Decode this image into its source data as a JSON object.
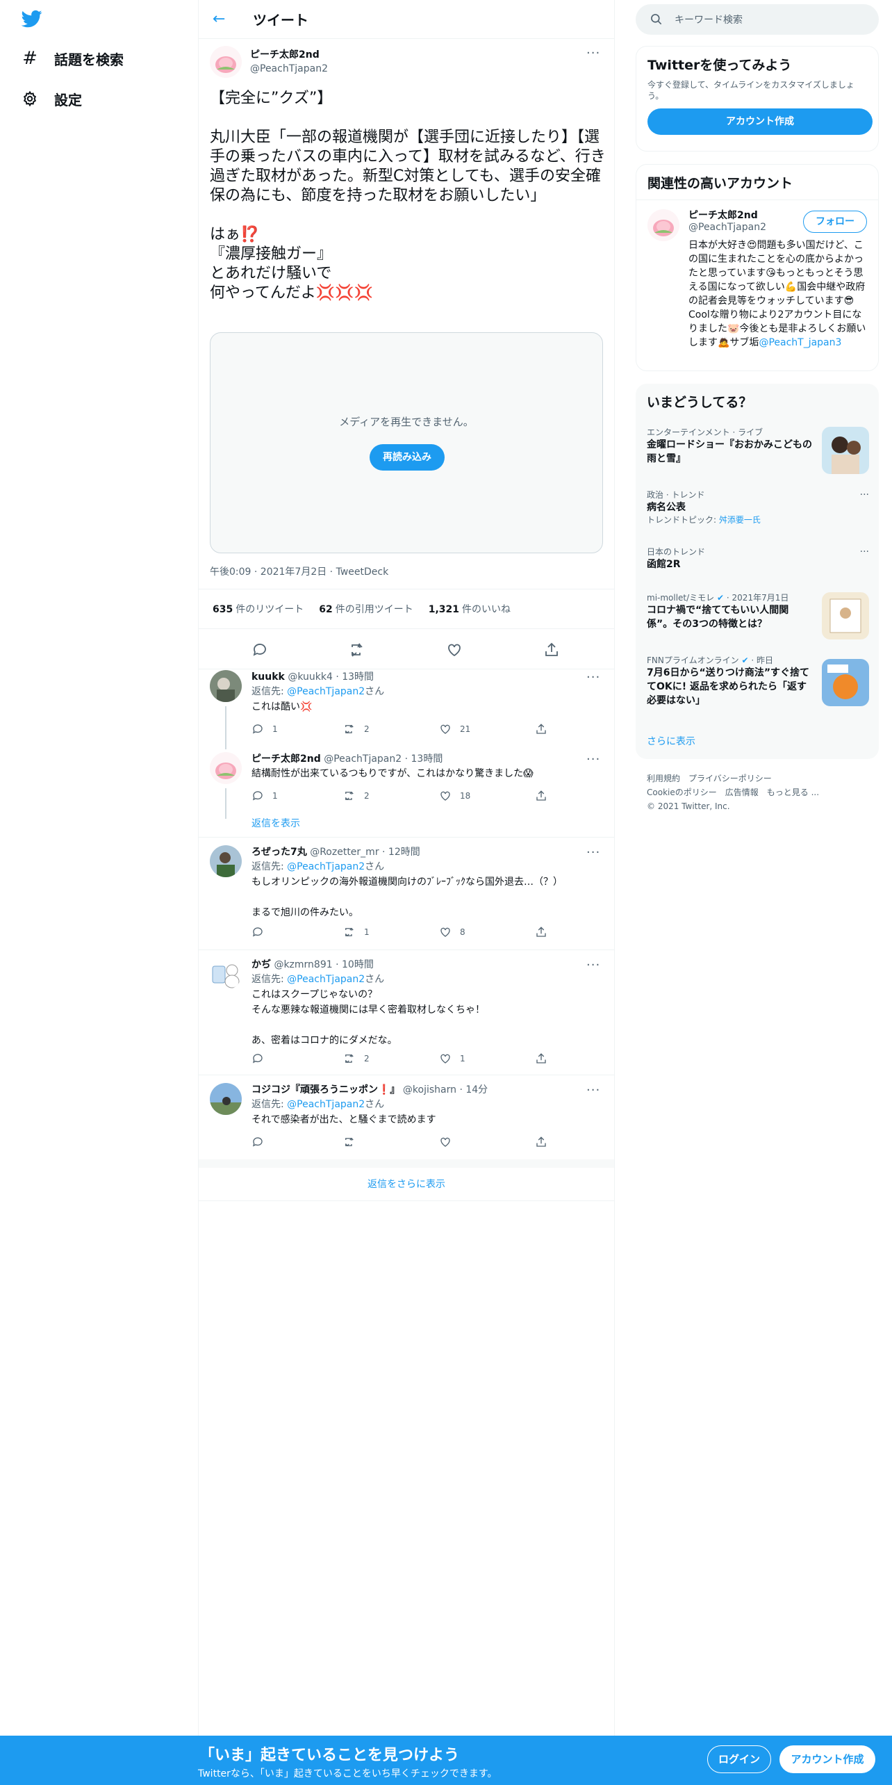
{
  "nav": {
    "explore_label": "話題を検索",
    "settings_label": "設定"
  },
  "header": {
    "title": "ツイート"
  },
  "tweet": {
    "name": "ピーチ太郎2nd",
    "handle": "@PeachTjapan2",
    "text": "【完全に”クズ”】\n\n丸川大臣「一部の報道機関が【選手団に近接したり】【選手の乗ったバスの車内に入って】取材を試みるなど、行き過ぎた取材があった。新型C対策としても、選手の安全確保の為にも、節度を持った取材をお願いしたい」\n\nはぁ⁉️\n『濃厚接触ガー』\nとあれだけ騒いで\n何やってんだよ💢💢💢",
    "media_message": "メディアを再生できません。",
    "reload_label": "再読み込み",
    "meta": "午後0:09 · 2021年7月2日 · TweetDeck",
    "retweets_count": "635",
    "retweets_label": "件のリツイート",
    "quotes_count": "62",
    "quotes_label": "件の引用ツイート",
    "likes_count": "1,321",
    "likes_label": "件のいいね"
  },
  "replies": [
    {
      "name": "kuukk",
      "handle": "@kuukk4",
      "time": "· 13時間",
      "reply_to_prefix": "返信先: ",
      "reply_to": "@PeachTjapan2",
      "reply_to_suffix": "さん",
      "text": "これは酷い💢",
      "replies": "1",
      "retweets": "2",
      "likes": "21"
    },
    {
      "name": "ピーチ太郎2nd",
      "handle": "@PeachTjapan2",
      "time": "· 13時間",
      "text": "結構耐性が出来ているつもりですが、これはかなり驚きました😱",
      "replies": "1",
      "retweets": "2",
      "likes": "18",
      "show_replies": "返信を表示"
    },
    {
      "name": "ろぜった7丸",
      "handle": "@Rozetter_mr",
      "time": "· 12時間",
      "reply_to_prefix": "返信先: ",
      "reply_to": "@PeachTjapan2",
      "reply_to_suffix": "さん",
      "text": "もしオリンピックの海外報道機関向けのﾌﾞﾚｰﾌﾞｯｸなら国外退去…（？）\n\nまるで旭川の件みたい。",
      "replies": "",
      "retweets": "1",
      "likes": "8"
    },
    {
      "name": "かぢ",
      "handle": "@kzmrn891",
      "time": "· 10時間",
      "reply_to_prefix": "返信先: ",
      "reply_to": "@PeachTjapan2",
      "reply_to_suffix": "さん",
      "text": "これはスクープじゃないの？\nそんな悪辣な報道機関には早く密着取材しなくちゃ！\n\nあ、密着はコロナ的にダメだな。",
      "replies": "",
      "retweets": "2",
      "likes": "1"
    },
    {
      "name": "コジコジ『頑張ろうニッポン❗』",
      "handle": "@kojisharn",
      "time": "· 14分",
      "reply_to_prefix": "返信先: ",
      "reply_to": "@PeachTjapan2",
      "reply_to_suffix": "さん",
      "text": "それで感染者が出た、と騒ぐまで読めます",
      "replies": "",
      "retweets": "",
      "likes": ""
    }
  ],
  "more_replies": "返信をさらに表示",
  "search": {
    "placeholder": "キーワード検索"
  },
  "join_card": {
    "title": "Twitterを使ってみよう",
    "desc": "今すぐ登録して、タイムラインをカスタマイズしましょう。",
    "button": "アカウント作成"
  },
  "related": {
    "title": "関連性の高いアカウント",
    "name": "ピーチ太郎2nd",
    "handle": "@PeachTjapan2",
    "follow": "フォロー",
    "bio": "日本が大好き😍問題も多い国だけど、この国に生まれたことを心の底からよかったと思っています😘もっともっとそう思える国になって欲しい💪国会中継や政府の記者会見等をウォッチしています😎Coolな贈り物により2アカウント目になりました🐷今後とも是非よろしくお願いします🙇サブ垢",
    "bio_link": "@PeachT_japan3"
  },
  "trends": {
    "title": "いまどうしてる？",
    "items": [
      {
        "category": "エンターテインメント · ライブ",
        "title": "金曜ロードショー『おおかみこどもの雨と雪』"
      },
      {
        "category": "政治 · トレンド",
        "title": "病名公表",
        "sub_prefix": "トレンドトピック: ",
        "sub_link": "舛添要一氏"
      },
      {
        "category": "日本のトレンド",
        "title": "函館2R"
      },
      {
        "source": "mi-mollet/ミモレ",
        "date": "· 2021年7月1日",
        "title": "コロナ禍で“捨ててもいい人間関係”。その3つの特徴とは？"
      },
      {
        "source": "FNNプライムオンライン",
        "date": "· 昨日",
        "title": "7月6日から“送りつけ商法”すぐ捨ててOKに! 返品を求められたら「返す必要はない」"
      }
    ],
    "show_more": "さらに表示"
  },
  "footer": {
    "terms": "利用規約",
    "privacy": "プライバシーポリシー",
    "cookie": "Cookieのポリシー",
    "ads": "広告情報",
    "more": "もっと見る ...",
    "copyright": "© 2021 Twitter, Inc."
  },
  "bottom_bar": {
    "title": "「いま」起きていることを見つけよう",
    "subtitle": "Twitterなら、「いま」起きていることをいち早くチェックできます。",
    "login": "ログイン",
    "signup": "アカウント作成"
  },
  "colors": {
    "accent": "#1d9bf0",
    "text": "#0f1419",
    "muted": "#536471",
    "border": "#eff3f4"
  }
}
